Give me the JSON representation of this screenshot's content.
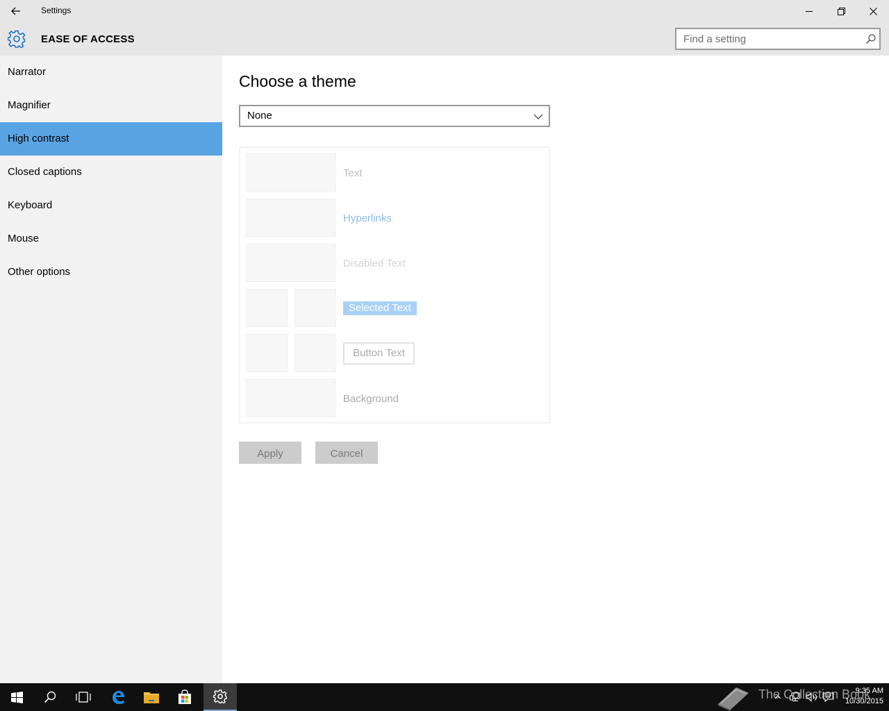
{
  "window": {
    "title": "Settings"
  },
  "header": {
    "title": "EASE OF ACCESS",
    "search_placeholder": "Find a setting"
  },
  "sidebar": {
    "items": [
      {
        "label": "Narrator"
      },
      {
        "label": "Magnifier"
      },
      {
        "label": "High contrast",
        "selected": true
      },
      {
        "label": "Closed captions"
      },
      {
        "label": "Keyboard"
      },
      {
        "label": "Mouse"
      },
      {
        "label": "Other options"
      }
    ]
  },
  "main": {
    "heading": "Choose a theme",
    "theme_dropdown": {
      "selected": "None"
    },
    "preview": {
      "text": "Text",
      "hyperlinks": "Hyperlinks",
      "disabled_text": "Disabled Text",
      "selected_text": "Selected Text",
      "button_text": "Button Text",
      "background": "Background"
    },
    "apply_label": "Apply",
    "cancel_label": "Cancel"
  },
  "taskbar": {
    "apps": [
      "windows-start",
      "search",
      "task-view",
      "edge",
      "file-explorer",
      "store",
      "settings"
    ],
    "active_app": "settings",
    "watermark": "The Collection Book",
    "time": "9:35 AM",
    "date": "10/30/2015"
  },
  "colors": {
    "accent": "#5aa3e3",
    "sidebar_bg": "#f2f2f2",
    "titlebar_bg": "#e6e6e6",
    "taskbar_bg": "#101010"
  }
}
